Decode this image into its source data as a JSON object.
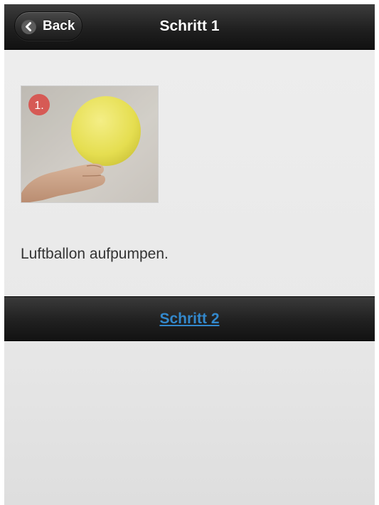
{
  "header": {
    "back_label": "Back",
    "back_icon": "chevron-left-icon",
    "title": "Schritt 1"
  },
  "content": {
    "image": {
      "description": "hand holding yellow balloon",
      "step_badge": "1."
    },
    "text": "Luftballon aufpumpen."
  },
  "footer": {
    "next_link_label": "Schritt 2"
  },
  "colors": {
    "link": "#3388cc",
    "badge": "#d9534f",
    "balloon": "#e8e25a"
  }
}
